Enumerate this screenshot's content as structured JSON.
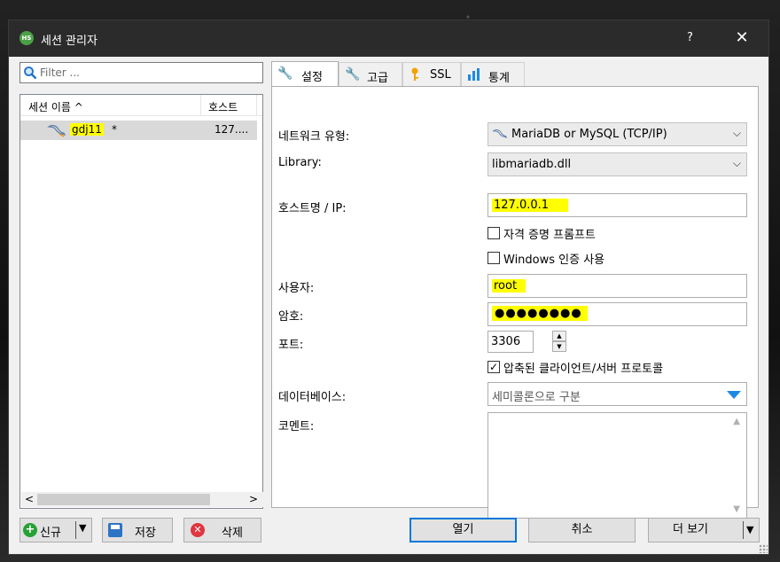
{
  "window": {
    "title": "세션 관리자",
    "app_icon_text": "HS",
    "help_label": "?",
    "close_label": "✕"
  },
  "left": {
    "filter_placeholder": "Filter ...",
    "columns": {
      "name": "세션 이름 ^",
      "host": "호스트"
    },
    "sessions": [
      {
        "name": "gdj11",
        "modified_marker": "*",
        "host": "127...."
      }
    ],
    "scroll_left": "<",
    "scroll_right": ">"
  },
  "bottom_left": {
    "new_label": "신규",
    "save_label": "저장",
    "delete_label": "삭제",
    "dropdown_arrow": "▼"
  },
  "tabs": [
    {
      "label": "설정",
      "icon": "wrench-icon",
      "active": true
    },
    {
      "label": "고급",
      "icon": "wrench-orange-icon",
      "active": false
    },
    {
      "label": "SSL",
      "icon": "key-icon",
      "active": false
    },
    {
      "label": "통계",
      "icon": "bar-chart-icon",
      "active": false
    }
  ],
  "settings": {
    "network_type_label": "네트워크 유형:",
    "network_type_value": "MariaDB or MySQL (TCP/IP)",
    "library_label": "Library:",
    "library_value": "libmariadb.dll",
    "hostname_label": "호스트명 / IP:",
    "hostname_value": "127.0.0.1",
    "prompt_credentials_label": "자격 증명 프롬프트",
    "prompt_credentials_checked": false,
    "windows_auth_label": "Windows 인증 사용",
    "windows_auth_checked": false,
    "user_label": "사용자:",
    "user_value": "root",
    "password_label": "암호:",
    "password_value": "●●●●●●●●",
    "port_label": "포트:",
    "port_value": "3306",
    "compressed_label": "압축된 클라이언트/서버 프로토콜",
    "compressed_checked": true,
    "databases_label": "데이터베이스:",
    "databases_placeholder": "세미콜론으로 구분",
    "comment_label": "코멘트:"
  },
  "actions": {
    "open_label": "열기",
    "cancel_label": "취소",
    "more_label": "더 보기",
    "more_arrow": "▼"
  },
  "colors": {
    "highlight": "#ffff00",
    "titlebar": "#2b2b2b",
    "accent": "#0078d7"
  }
}
